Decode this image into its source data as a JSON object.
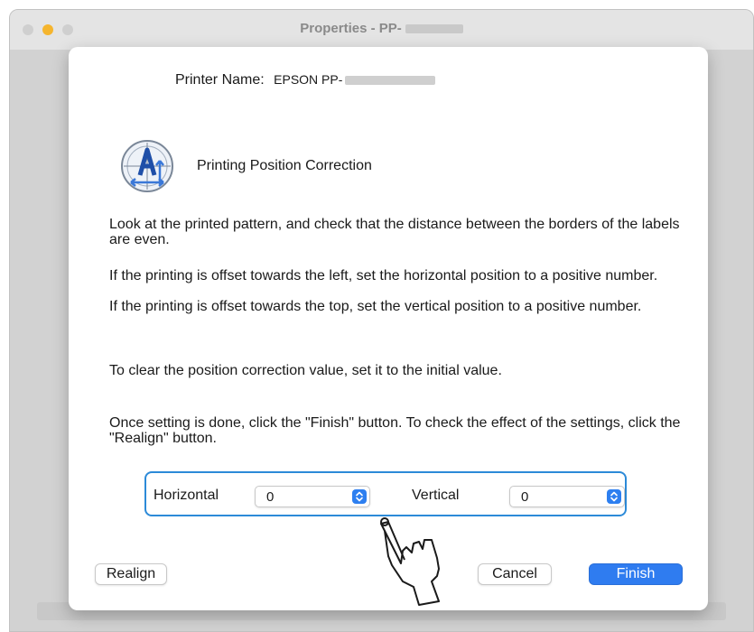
{
  "window": {
    "title": "Properties - PP-",
    "title_redacted": true
  },
  "printer": {
    "label": "Printer Name:",
    "value": "EPSON PP-",
    "value_redacted": true
  },
  "section": {
    "icon": "position-correction-icon",
    "title": "Printing Position Correction"
  },
  "paragraphs": {
    "p1": "Look at the printed pattern, and check that the distance between the borders of the labels are even.",
    "p2": "If the printing is offset towards the left, set the horizontal position to a positive number.",
    "p3": "If the printing is offset towards the top, set the vertical position to a positive number.",
    "p4": "To clear the position correction value, set it to the initial value.",
    "p5": "Once setting is done, click the \"Finish\" button. To check the effect of the settings, click the \"Realign\" button."
  },
  "controls": {
    "horizontal_label": "Horizontal",
    "horizontal_value": "0",
    "vertical_label": "Vertical",
    "vertical_value": "0"
  },
  "buttons": {
    "realign": "Realign",
    "cancel": "Cancel",
    "finish": "Finish"
  },
  "colors": {
    "accent": "#2f7cf0",
    "highlight_border": "#2c8ad8",
    "minimize_button": "#f5b52e"
  },
  "annotation": {
    "icon": "pointing-hand-icon"
  }
}
